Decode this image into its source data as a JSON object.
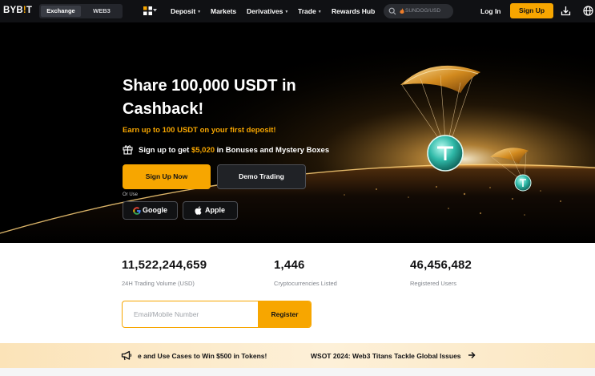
{
  "nav": {
    "logo_main": "BYB",
    "logo_accent": "!",
    "logo_end": "T",
    "segment": [
      "Exchange",
      "WEB3"
    ],
    "items": [
      {
        "label": "Deposit",
        "dropdown": true
      },
      {
        "label": "Markets",
        "dropdown": false
      },
      {
        "label": "Derivatives",
        "dropdown": true
      },
      {
        "label": "Trade",
        "dropdown": true
      },
      {
        "label": "Rewards Hub",
        "dropdown": false
      }
    ],
    "search_placeholder": "SUNDOG/USD",
    "login": "Log In",
    "signup": "Sign Up",
    "icons": [
      "grid-icon",
      "search-icon",
      "flame-icon",
      "download-icon",
      "globe-icon"
    ]
  },
  "hero": {
    "title": "Share 100,000 USDT in Cashback!",
    "subtitle": "Earn up to 100 USDT on your first deposit!",
    "bonus_prefix": "Sign up to get ",
    "bonus_amount": "$5,020",
    "bonus_suffix": " in Bonuses and Mystery Boxes",
    "signup_button": "Sign Up Now",
    "demo_button": "Demo Trading",
    "or_use": "Or Use",
    "google_button": "Google",
    "apple_button": "Apple"
  },
  "stats": [
    {
      "value": "11,522,244,659",
      "label": "24H Trading Volume (USD)"
    },
    {
      "value": "1,446",
      "label": "Cryptocurrencies Listed"
    },
    {
      "value": "46,456,482",
      "label": "Registered Users"
    }
  ],
  "register": {
    "placeholder": "Email/Mobile Number",
    "button": "Register"
  },
  "announcements": [
    "e and Use Cases to Win $500 in Tokens!",
    "WSOT 2024: Web3 Titans Tackle Global Issues"
  ],
  "colors": {
    "accent": "#f7a600",
    "nav_bg": "#101114",
    "hero_bg": "#000000",
    "announce_bg": "#fdebc8"
  }
}
